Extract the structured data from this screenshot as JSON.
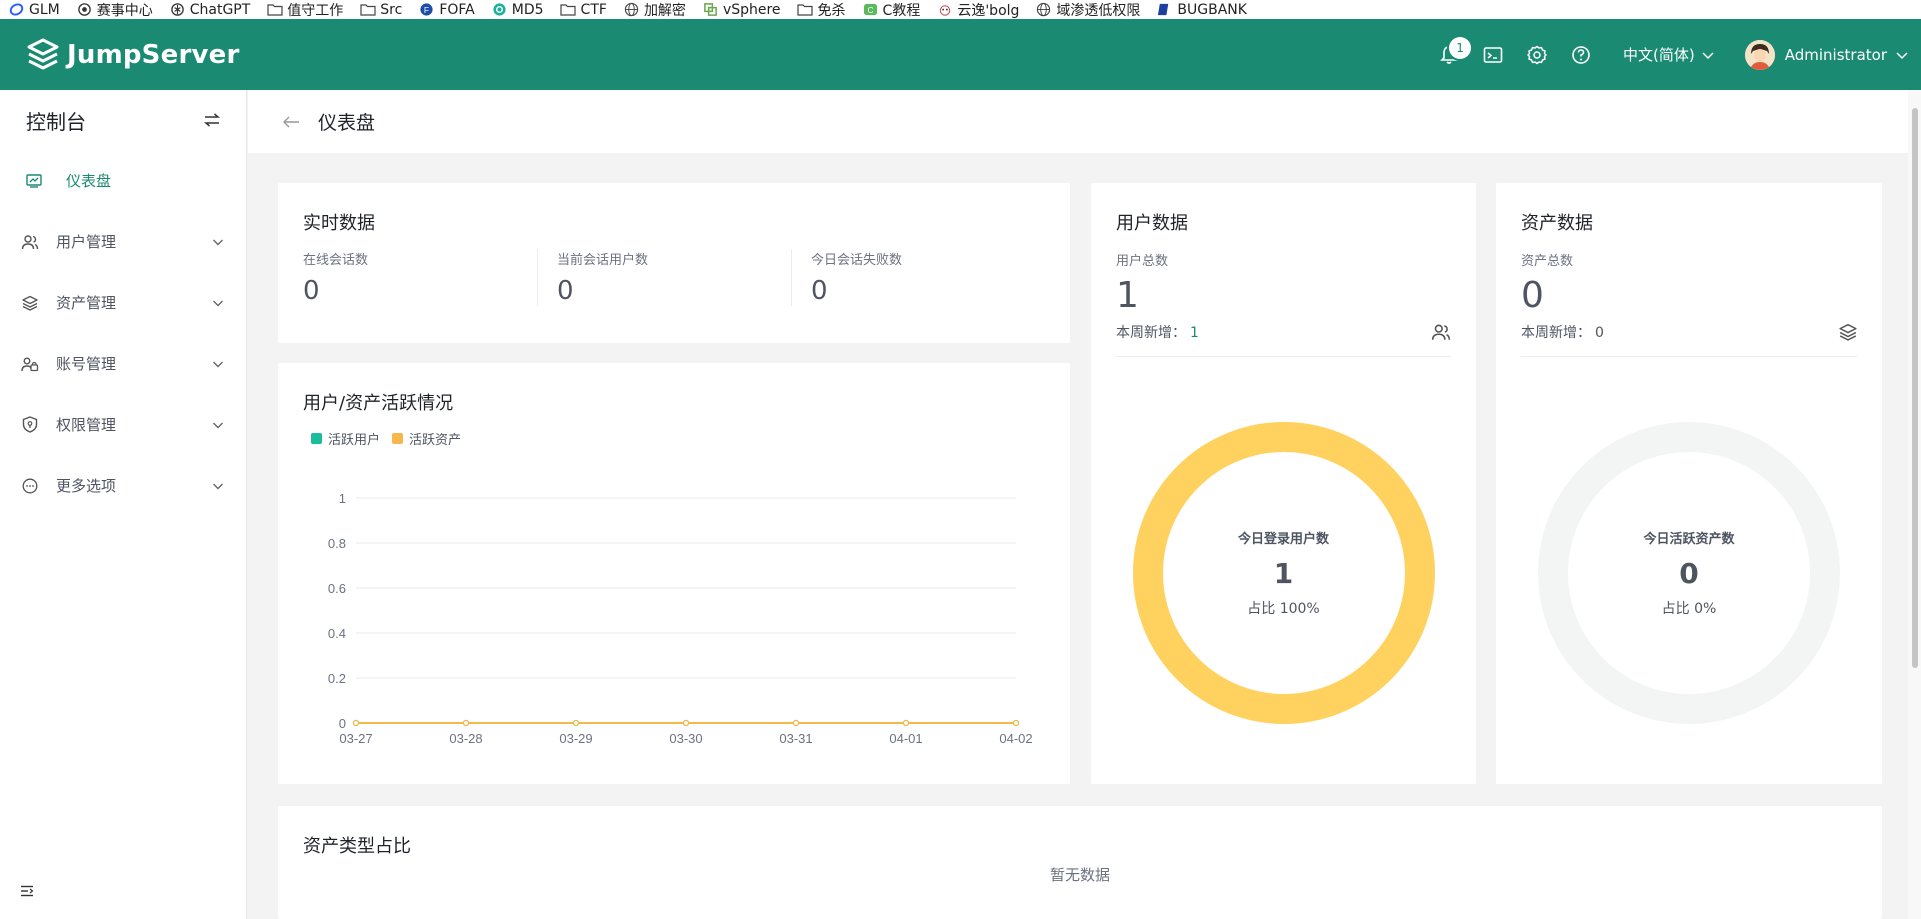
{
  "bookmarks": [
    {
      "label": "GLM",
      "icon": "glm-icon"
    },
    {
      "label": "赛事中心",
      "icon": "target-icon"
    },
    {
      "label": "ChatGPT",
      "icon": "chatgpt-icon"
    },
    {
      "label": "值守工作",
      "icon": "folder-icon"
    },
    {
      "label": "Src",
      "icon": "folder-icon"
    },
    {
      "label": "FOFA",
      "icon": "fofa-icon"
    },
    {
      "label": "MD5",
      "icon": "md5-icon"
    },
    {
      "label": "CTF",
      "icon": "folder-icon"
    },
    {
      "label": "加解密",
      "icon": "globe-icon"
    },
    {
      "label": "vSphere",
      "icon": "vsphere-icon"
    },
    {
      "label": "免杀",
      "icon": "folder-icon"
    },
    {
      "label": "C教程",
      "icon": "c-icon"
    },
    {
      "label": "云逸'bolg",
      "icon": "cloud-icon"
    },
    {
      "label": "域渗透低权限",
      "icon": "globe-icon"
    },
    {
      "label": "BUGBANK",
      "icon": "bugbank-icon"
    }
  ],
  "header": {
    "brand": "JumpServer",
    "notification_count": "1",
    "language": "中文(简体)",
    "username": "Administrator",
    "brand_color": "#1a8a73"
  },
  "sidebar": {
    "title": "控制台",
    "items": [
      {
        "label": "仪表盘",
        "icon": "dashboard-icon",
        "active": true
      },
      {
        "label": "用户管理",
        "icon": "users-icon"
      },
      {
        "label": "资产管理",
        "icon": "layers-icon"
      },
      {
        "label": "账号管理",
        "icon": "account-icon"
      },
      {
        "label": "权限管理",
        "icon": "shield-icon"
      },
      {
        "label": "更多选项",
        "icon": "more-icon"
      }
    ]
  },
  "page": {
    "title": "仪表盘"
  },
  "realtime": {
    "title": "实时数据",
    "stats": [
      {
        "label": "在线会话数",
        "value": "0"
      },
      {
        "label": "当前会话用户数",
        "value": "0"
      },
      {
        "label": "今日会话失败数",
        "value": "0"
      }
    ]
  },
  "activity": {
    "title": "用户/资产活跃情况"
  },
  "chart_data": {
    "type": "line",
    "x": [
      "03-27",
      "03-28",
      "03-29",
      "03-30",
      "03-31",
      "04-01",
      "04-02"
    ],
    "series": [
      {
        "name": "活跃用户",
        "color": "#1abc9c",
        "values": [
          0,
          0,
          0,
          0,
          0,
          0,
          0
        ]
      },
      {
        "name": "活跃资产",
        "color": "#f7b84b",
        "values": [
          0,
          0,
          0,
          0,
          0,
          0,
          0
        ]
      }
    ],
    "y_ticks": [
      "0",
      "0.2",
      "0.4",
      "0.6",
      "0.8",
      "1"
    ],
    "ylim": [
      0,
      1
    ],
    "legend": "top-left",
    "grid": true
  },
  "user_data": {
    "title": "用户数据",
    "total_label": "用户总数",
    "total": "1",
    "weekly_label": "本周新增：",
    "weekly_value": "1",
    "donut": {
      "title": "今日登录用户数",
      "value": "1",
      "ratio": "占比 100%",
      "percent": 100,
      "color": "#ffd25f"
    }
  },
  "asset_data": {
    "title": "资产数据",
    "total_label": "资产总数",
    "total": "0",
    "weekly_label": "本周新增：",
    "weekly_value": "0",
    "donut": {
      "title": "今日活跃资产数",
      "value": "0",
      "ratio": "占比 0%",
      "percent": 0,
      "color": "#f3f5f4"
    }
  },
  "asset_type": {
    "title": "资产类型占比",
    "empty": "暂无数据"
  }
}
